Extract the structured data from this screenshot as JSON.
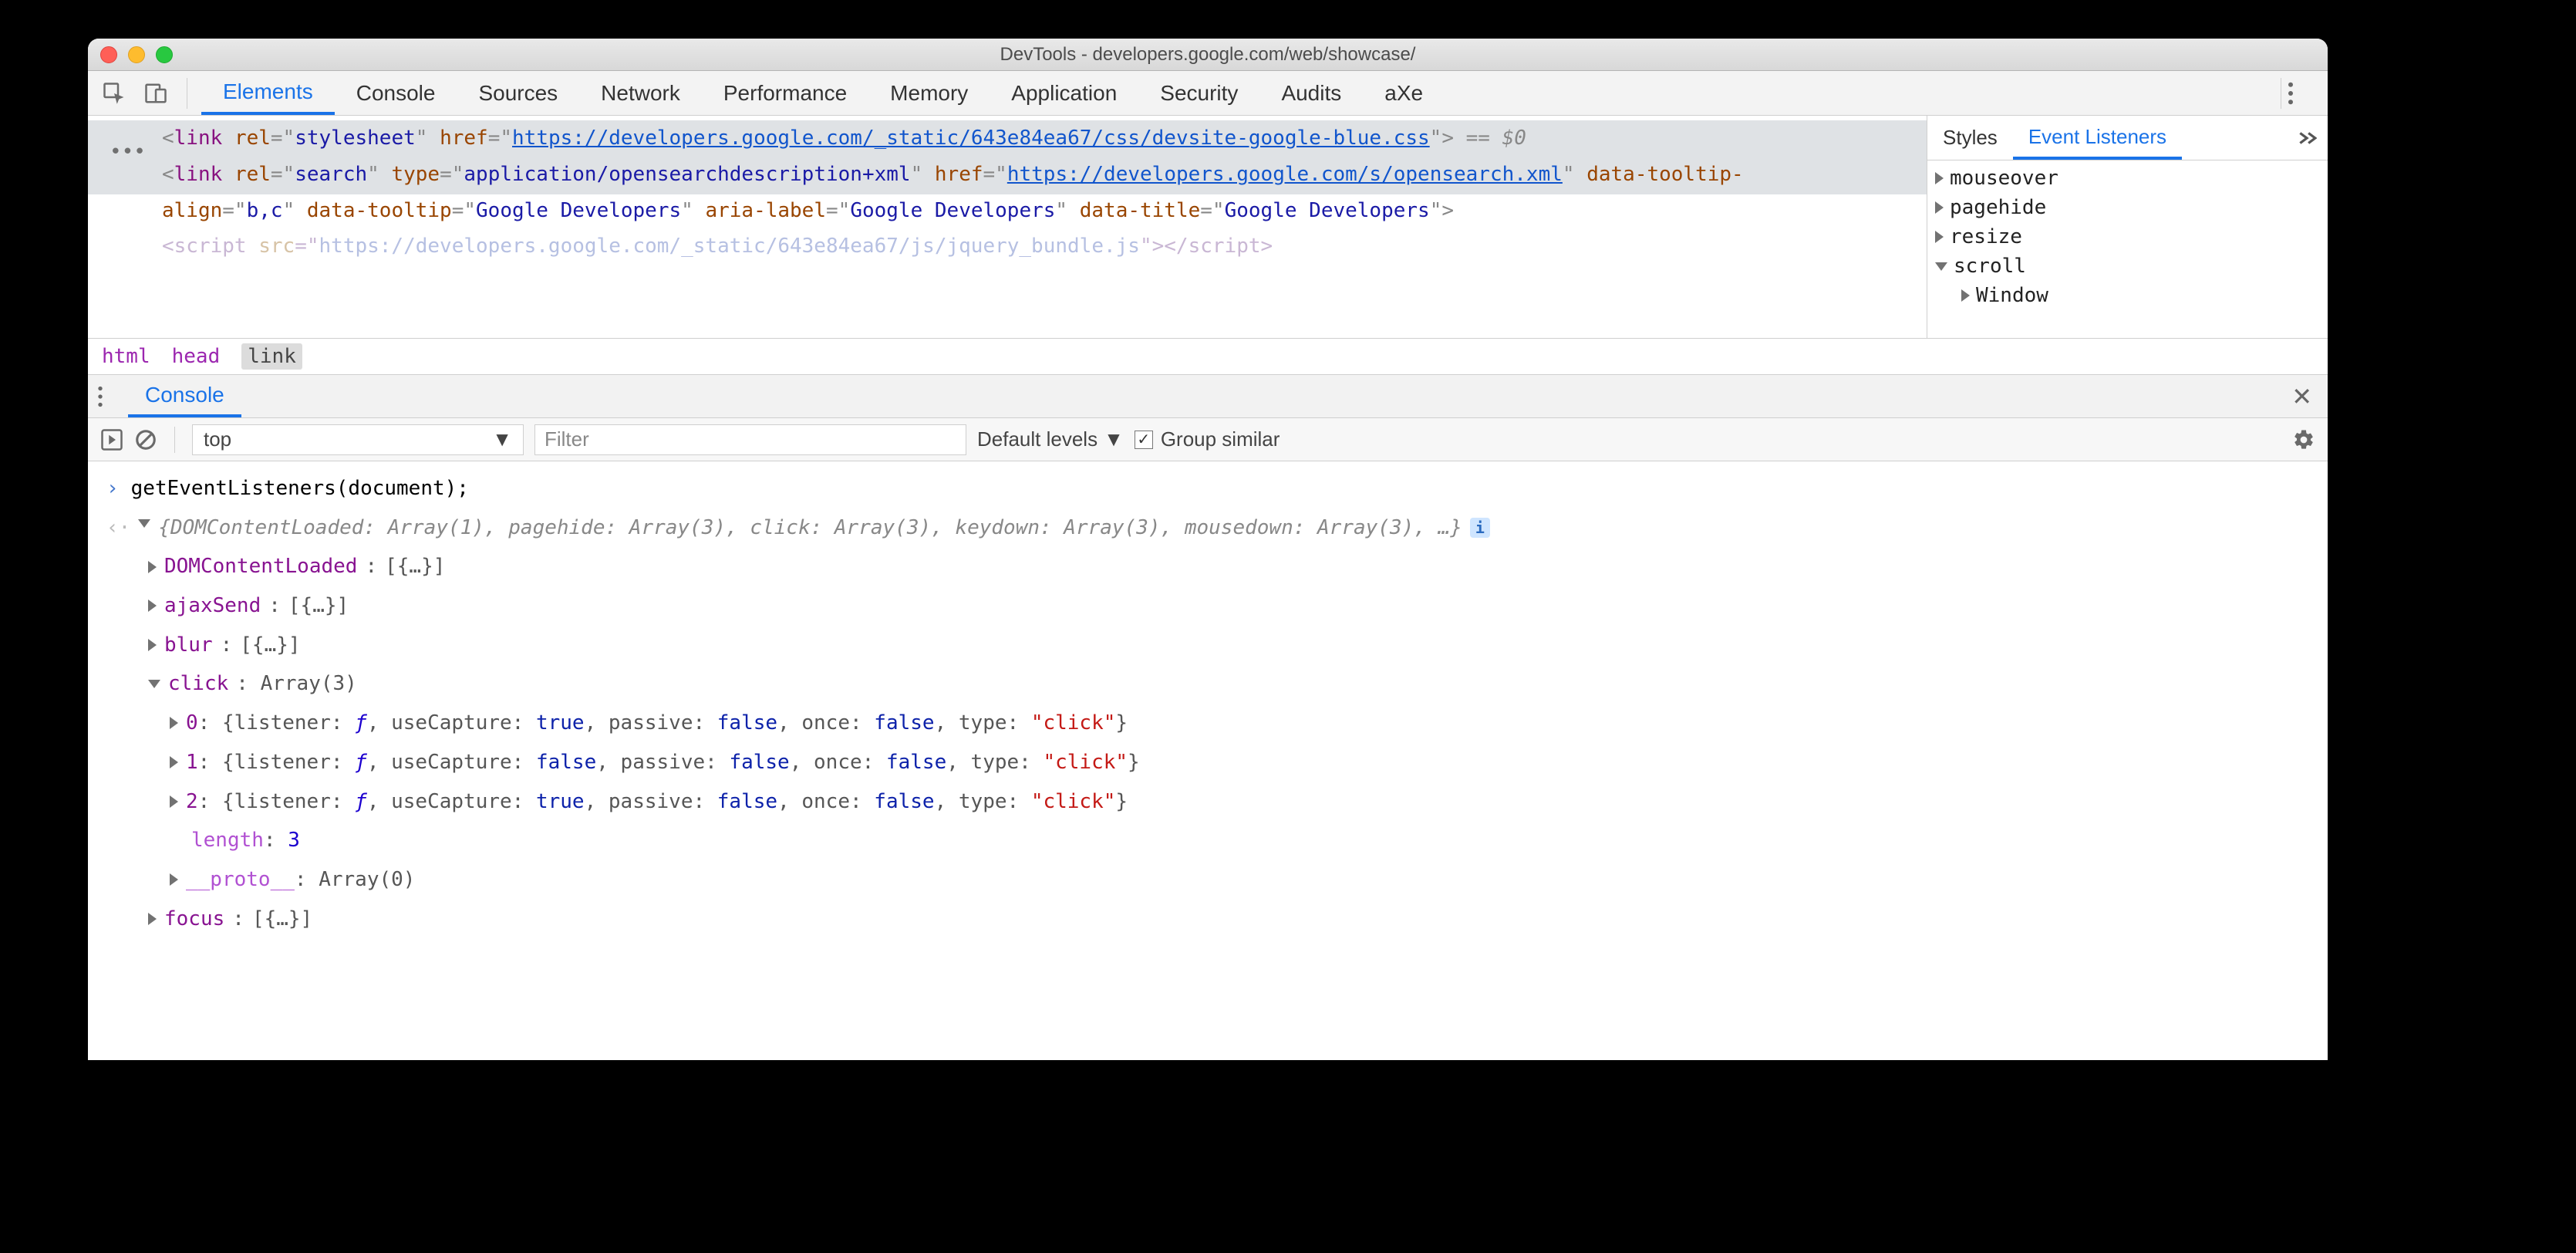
{
  "window": {
    "title": "DevTools - developers.google.com/web/showcase/"
  },
  "toolbar": {
    "tabs": [
      "Elements",
      "Console",
      "Sources",
      "Network",
      "Performance",
      "Memory",
      "Application",
      "Security",
      "Audits",
      "aXe"
    ],
    "activeTab": "Elements"
  },
  "elements": {
    "selected_line_1a": "<link rel=\"stylesheet\" href=\"",
    "selected_link": "https://developers.google.com/_static/643e84ea67/css/devsite-google-blue.css",
    "selected_line_1b": "\"> == $0",
    "line2a": "<link rel=\"search\" type=\"application/opensearchdescription+xml\" href=\"",
    "line2_link": "https://developers.google.com/s/opensearch.xml",
    "line2b": "\" data-tooltip-align=\"b,c\" data-tooltip=\"Google Developers\" aria-label=\"Google Developers\" data-title=\"Google Developers\">",
    "line3": "<script src=\"https://developers.google.com/_static/643e84ea67/js/jquery_bundle.js\"></script>"
  },
  "breadcrumbs": [
    "html",
    "head",
    "link"
  ],
  "sidepanel": {
    "tabs": [
      "Styles",
      "Event Listeners"
    ],
    "activeTab": "Event Listeners",
    "events": {
      "items": [
        "mouseover",
        "pagehide",
        "resize",
        "scroll"
      ],
      "expanded": "scroll",
      "child": "Window"
    }
  },
  "drawer": {
    "tab": "Console",
    "context": "top",
    "filter_placeholder": "Filter",
    "levels": "Default levels",
    "group_similar": "Group similar"
  },
  "console": {
    "command": "getEventListeners(document);",
    "summary": "{DOMContentLoaded: Array(1), pagehide: Array(3), click: Array(3), keydown: Array(3), mousedown: Array(3), …}",
    "tree": {
      "DOMContentLoaded": "[{…}]",
      "ajaxSend": "[{…}]",
      "blur": "[{…}]",
      "click_label": "click: Array(3)",
      "click": [
        {
          "idx": "0",
          "useCapture": "true",
          "passive": "false",
          "once": "false",
          "type": "\"click\""
        },
        {
          "idx": "1",
          "useCapture": "false",
          "passive": "false",
          "once": "false",
          "type": "\"click\""
        },
        {
          "idx": "2",
          "useCapture": "true",
          "passive": "false",
          "once": "false",
          "type": "\"click\""
        }
      ],
      "length_label": "length",
      "length_val": "3",
      "proto_label": "__proto__",
      "proto_val": "Array(0)",
      "focus": "[{…}]"
    }
  }
}
